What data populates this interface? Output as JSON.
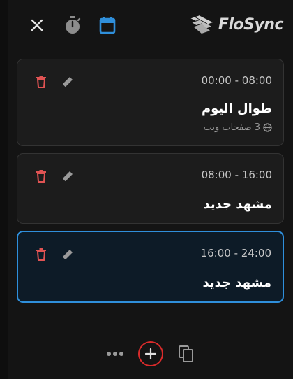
{
  "app": {
    "name": "FloSync",
    "accent": "#2f8fdb",
    "danger": "#e05353"
  },
  "toolbar": {
    "icons": [
      "close-icon",
      "timer-icon",
      "calendar-icon"
    ]
  },
  "schedules": [
    {
      "time": "00:00 - 08:00",
      "title": "طوال اليوم",
      "subtitle": "3 صفحات ويب",
      "active": false
    },
    {
      "time": "08:00 - 16:00",
      "title": "مشهد جديد",
      "active": false
    },
    {
      "time": "16:00 - 24:00",
      "title": "مشهد جديد",
      "active": true
    }
  ],
  "footer": {
    "icons": [
      "more-icon",
      "add-icon",
      "duplicate-icon"
    ]
  }
}
